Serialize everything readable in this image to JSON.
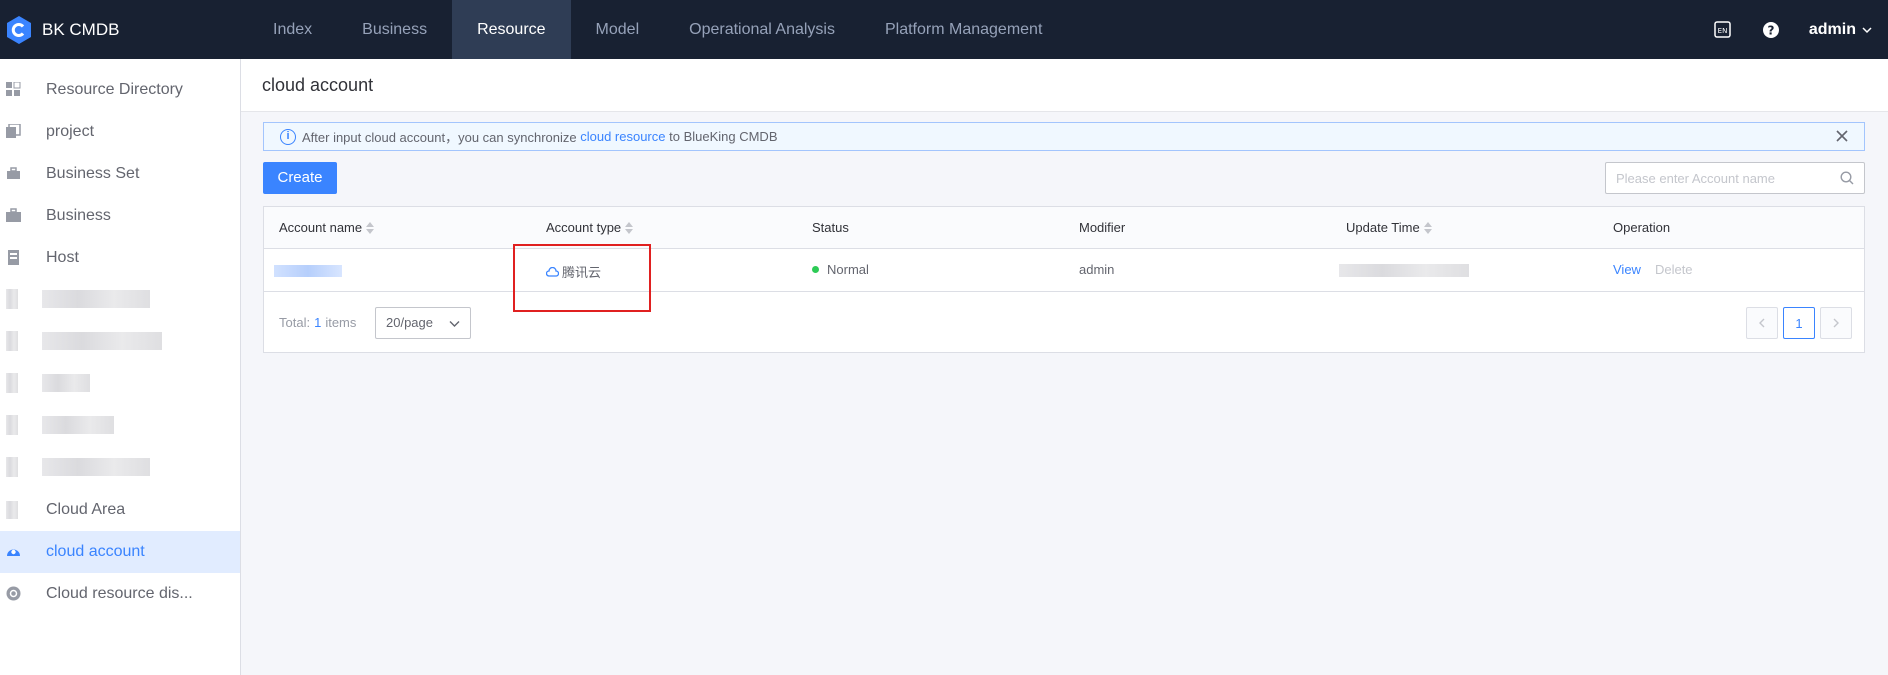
{
  "app": {
    "name": "BK CMDB"
  },
  "nav": {
    "items": [
      {
        "label": "Index"
      },
      {
        "label": "Business"
      },
      {
        "label": "Resource"
      },
      {
        "label": "Model"
      },
      {
        "label": "Operational Analysis"
      },
      {
        "label": "Platform Management"
      }
    ],
    "active": "Resource"
  },
  "user": {
    "name": "admin"
  },
  "sidebar": {
    "items": [
      {
        "label": "Resource Directory"
      },
      {
        "label": "project"
      },
      {
        "label": "Business Set"
      },
      {
        "label": "Business"
      },
      {
        "label": "Host"
      },
      {
        "label": "Cloud Area"
      },
      {
        "label": "cloud account"
      },
      {
        "label": "Cloud resource dis..."
      }
    ],
    "active": "cloud account"
  },
  "page": {
    "title": "cloud account"
  },
  "alert": {
    "text_before": "After input cloud account，you can synchronize ",
    "link": "cloud resource",
    "text_after": " to BlueKing CMDB"
  },
  "toolbar": {
    "create_label": "Create",
    "search_placeholder": "Please enter Account name"
  },
  "table": {
    "columns": [
      "Account name",
      "Account type",
      "Status",
      "Modifier",
      "Update Time",
      "Operation"
    ],
    "rows": [
      {
        "account_type": "腾讯云",
        "status": "Normal",
        "modifier": "admin",
        "actions": [
          "View",
          "Delete"
        ]
      }
    ]
  },
  "pagination": {
    "total_label": "Total:",
    "total": "1",
    "unit": "items",
    "page_size": "20/page",
    "current_page": "1"
  },
  "colors": {
    "brand": "#3a84ff",
    "topbar": "#182132",
    "status_normal": "#2dcb56",
    "highlight": "#e02020"
  }
}
